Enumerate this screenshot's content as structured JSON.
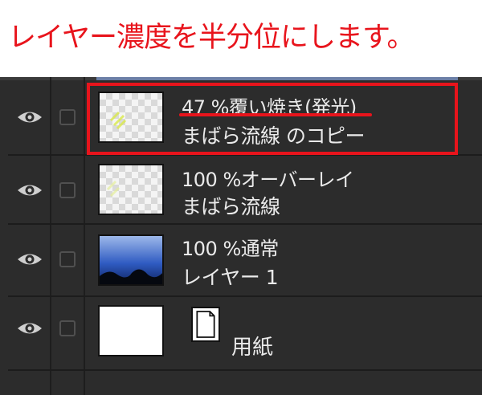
{
  "caption": "レイヤー濃度を半分位にします。",
  "colors": {
    "highlight": "#e8141c",
    "panel_bg": "#2c2c2c",
    "text": "#eaeaea"
  },
  "layers": [
    {
      "line1": "47 %覆い焼き(発光)",
      "line2": "まばら流線 のコピー",
      "thumbnail": "transparent-with-yellow-lines",
      "visible": true
    },
    {
      "line1": "100 %オーバーレイ",
      "line2": "まばら流線",
      "thumbnail": "transparent-with-yellow-lines",
      "visible": true
    },
    {
      "line1": "100 %通常",
      "line2": "レイヤー 1",
      "thumbnail": "blue-gradient",
      "visible": true
    },
    {
      "line2": "用紙",
      "thumbnail": "white-paper",
      "icon": "paper-icon",
      "visible": true
    }
  ]
}
